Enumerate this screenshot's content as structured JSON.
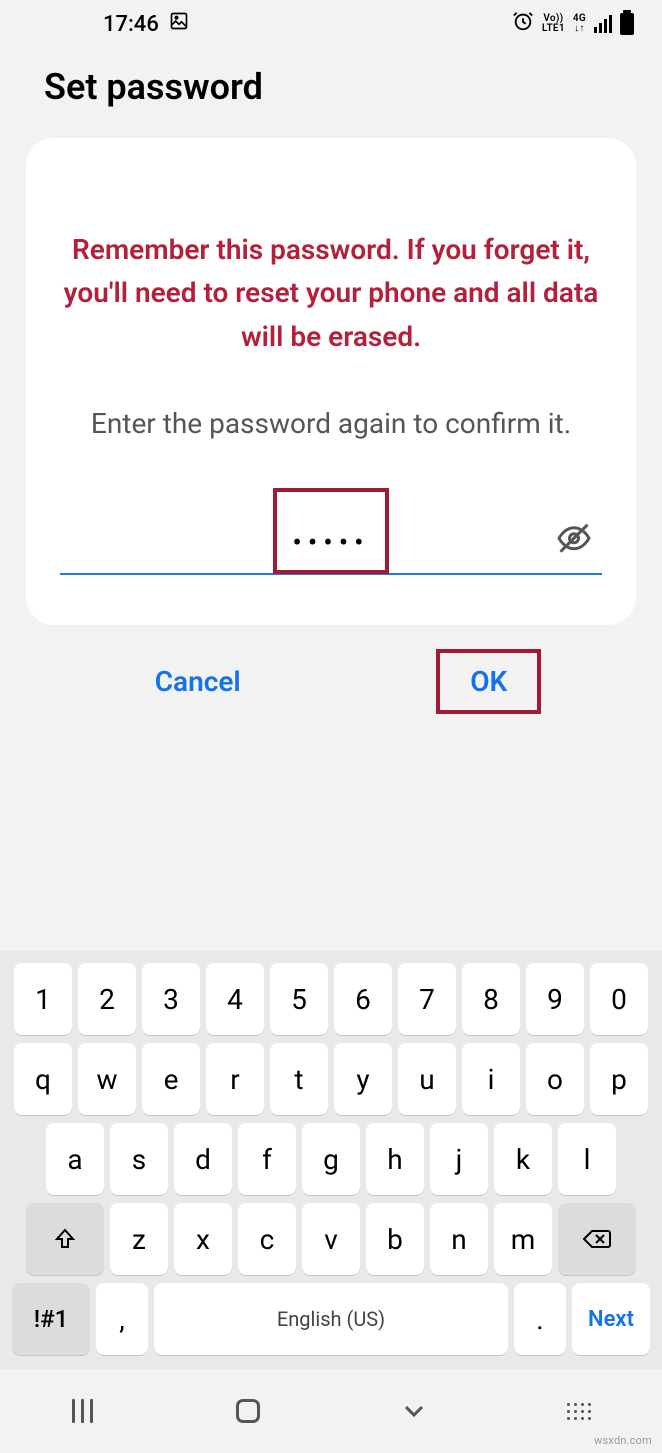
{
  "status": {
    "time": "17:46",
    "volte_top": "Vo))",
    "volte_bot": "LTE1",
    "net_top": "4G",
    "net_bot": "↓↑"
  },
  "page": {
    "title": "Set password",
    "warning": "Remember this password. If you forget it, you'll need to reset your phone and all data will be erased.",
    "instruction": "Enter the password again to confirm it.",
    "password_value": "•••••"
  },
  "actions": {
    "cancel": "Cancel",
    "ok": "OK"
  },
  "keyboard": {
    "row_num": [
      "1",
      "2",
      "3",
      "4",
      "5",
      "6",
      "7",
      "8",
      "9",
      "0"
    ],
    "row_q": [
      "q",
      "w",
      "e",
      "r",
      "t",
      "y",
      "u",
      "i",
      "o",
      "p"
    ],
    "row_a": [
      "a",
      "s",
      "d",
      "f",
      "g",
      "h",
      "j",
      "k",
      "l"
    ],
    "row_z": [
      "z",
      "x",
      "c",
      "v",
      "b",
      "n",
      "m"
    ],
    "sym": "!#1",
    "comma": ",",
    "space": "English (US)",
    "period": ".",
    "next": "Next"
  },
  "watermark": "wsxdn.com"
}
